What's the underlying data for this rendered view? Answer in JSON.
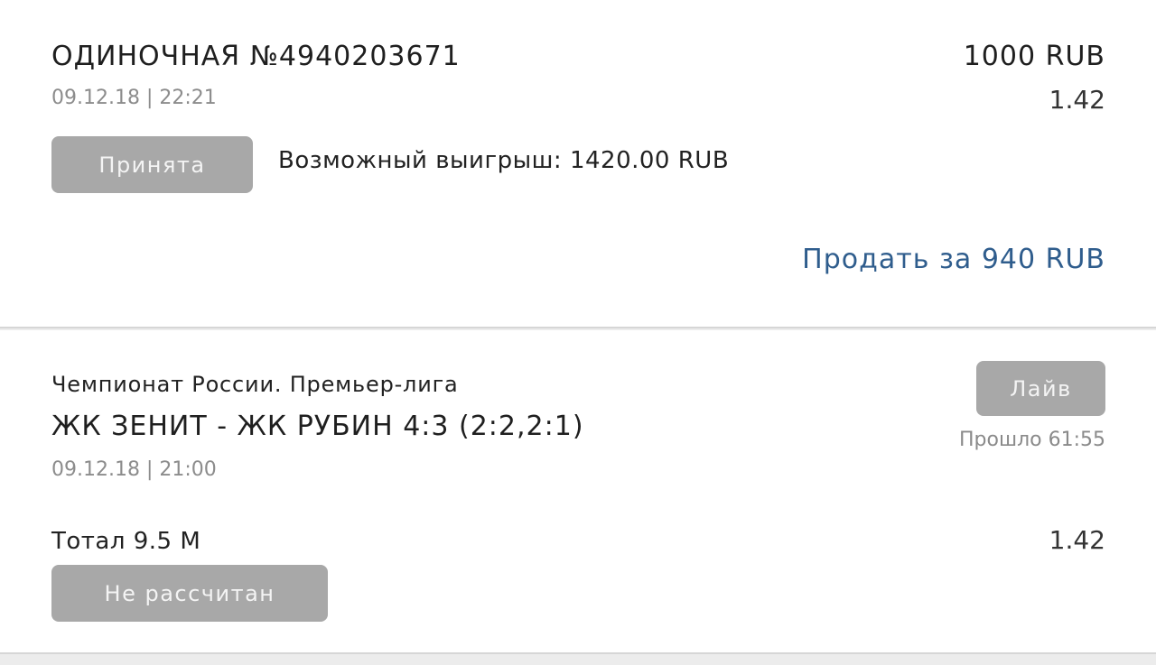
{
  "bet": {
    "title": "ОДИНОЧНАЯ №4940203671",
    "datetime": "09.12.18 | 22:21",
    "stake": "1000 RUB",
    "coef": "1.42",
    "status": "Принята",
    "possible_win": "Возможный выигрыш: 1420.00 RUB",
    "sell_label": "Продать за 940 RUB"
  },
  "event": {
    "league": "Чемпионат России. Премьер-лига",
    "teams_score": "ЖК ЗЕНИТ - ЖК РУБИН 4:3 (2:2,2:1)",
    "datetime": "09.12.18 | 21:00",
    "live_badge": "Лайв",
    "elapsed": "Прошло 61:55",
    "market": "Тотал 9.5 М",
    "coef": "1.42",
    "result_status": "Не рассчитан"
  }
}
